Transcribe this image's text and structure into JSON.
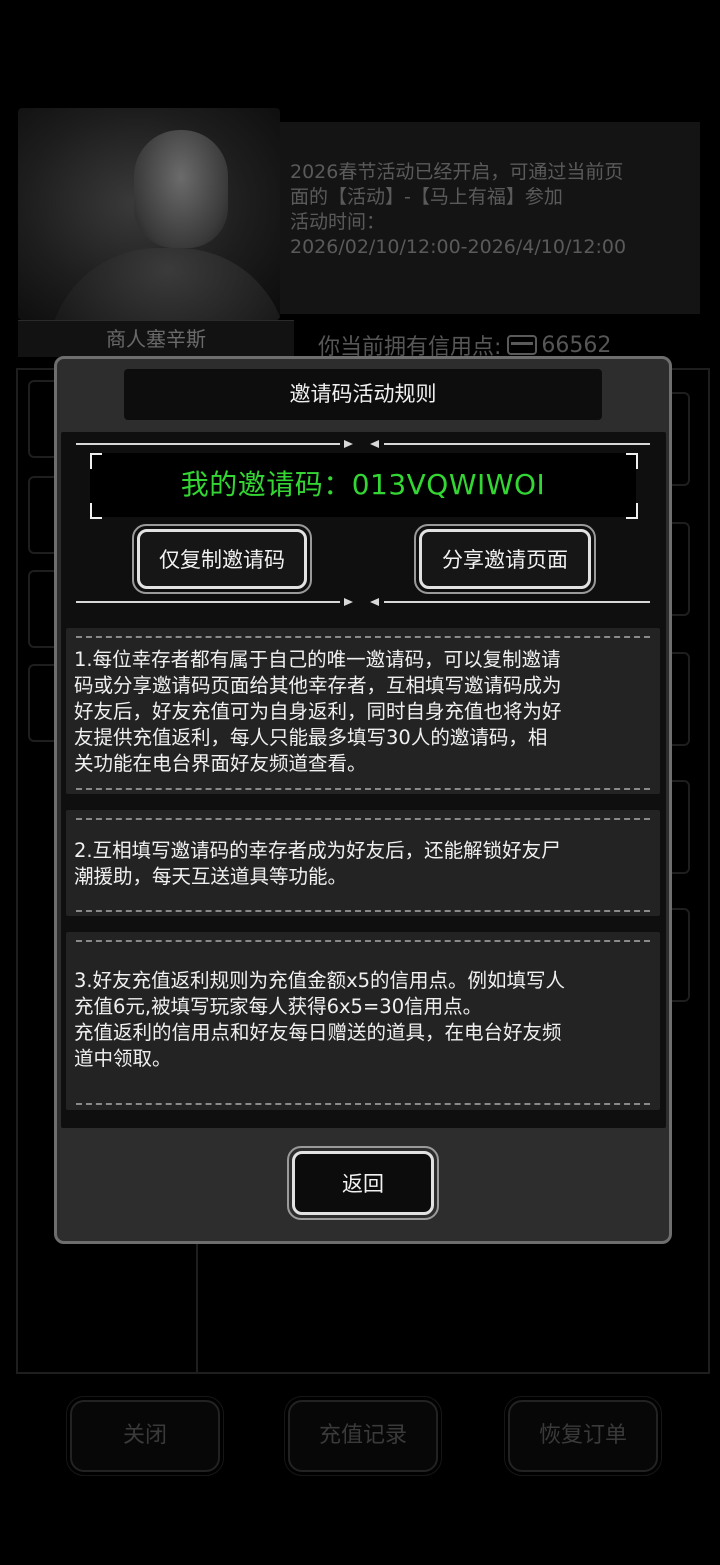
{
  "background": {
    "npc_name": "商人塞辛斯",
    "notice_lines": [
      "2026春节活动已经开启，可通过当前页",
      "面的【活动】-【马上有福】参加",
      "活动时间：",
      "2026/02/10/12:00-2026/4/10/12:00"
    ],
    "credit_label": "你当前拥有信用点:",
    "credit_icon": "credit-card-icon",
    "credit_value": "66562",
    "buttons": {
      "close": "关闭",
      "recharge_history": "充值记录",
      "restore_order": "恢复订单"
    }
  },
  "modal": {
    "title": "邀请码活动规则",
    "invite_code_label": "我的邀请码：013VQWIWOI",
    "copy_button": "仅复制邀请码",
    "share_button": "分享邀请页面",
    "rules": [
      {
        "lines": [
          "1.每位幸存者都有属于自己的唯一邀请码，可以复制邀请",
          "码或分享邀请码页面给其他幸存者，互相填写邀请码成为",
          "好友后，好友充值可为自身返利，同时自身充值也将为好",
          "友提供充值返利，每人只能最多填写30人的邀请码，相",
          "关功能在电台界面好友频道查看。"
        ]
      },
      {
        "lines": [
          "2.互相填写邀请码的幸存者成为好友后，还能解锁好友尸",
          "潮援助，每天互送道具等功能。"
        ]
      },
      {
        "lines": [
          "3.好友充值返利规则为充值金额x5的信用点。例如填写人",
          "充值6元,被填写玩家每人获得6x5=30信用点。",
          "充值返利的信用点和好友每日赠送的道具，在电台好友频",
          "道中领取。"
        ]
      }
    ],
    "back_button": "返回"
  },
  "colors": {
    "invite_code": "#33d633",
    "modal_border": "#6e6e6e",
    "panel": "#232323"
  }
}
